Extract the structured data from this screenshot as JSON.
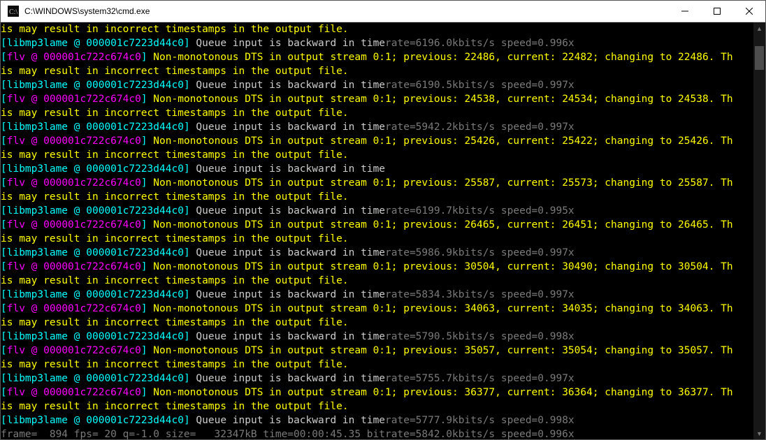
{
  "window": {
    "title": "C:\\WINDOWS\\system32\\cmd.exe"
  },
  "scrollbar": {
    "thumb_top_pct": 3,
    "thumb_height_pct": 6
  },
  "tags": {
    "mp3": {
      "name": "libmp3lame",
      "addr": "000001c7223d44c0"
    },
    "flv": {
      "name": "flv",
      "addr": "000001c722c674c0"
    }
  },
  "strings": {
    "queue_msg": "Queue input is backward in time",
    "wrap_msg": "is may result in incorrect timestamps in the output file."
  },
  "entries": [
    {
      "type": "wrap"
    },
    {
      "type": "mp3",
      "rate": "6196.0kbits/s",
      "speed": "0.996x"
    },
    {
      "type": "flv",
      "prev": "22486",
      "curr": "22482",
      "chg": "22486"
    },
    {
      "type": "wrap"
    },
    {
      "type": "mp3",
      "rate": "6190.5kbits/s",
      "speed": "0.997x"
    },
    {
      "type": "flv",
      "prev": "24538",
      "curr": "24534",
      "chg": "24538"
    },
    {
      "type": "wrap"
    },
    {
      "type": "mp3",
      "rate": "5942.2kbits/s",
      "speed": "0.997x"
    },
    {
      "type": "flv",
      "prev": "25426",
      "curr": "25422",
      "chg": "25426"
    },
    {
      "type": "wrap"
    },
    {
      "type": "mp3",
      "rate": null,
      "speed": null
    },
    {
      "type": "flv",
      "prev": "25587",
      "curr": "25573",
      "chg": "25587"
    },
    {
      "type": "wrap"
    },
    {
      "type": "mp3",
      "rate": "6199.7kbits/s",
      "speed": "0.995x"
    },
    {
      "type": "flv",
      "prev": "26465",
      "curr": "26451",
      "chg": "26465"
    },
    {
      "type": "wrap"
    },
    {
      "type": "mp3",
      "rate": "5986.9kbits/s",
      "speed": "0.997x"
    },
    {
      "type": "flv",
      "prev": "30504",
      "curr": "30490",
      "chg": "30504"
    },
    {
      "type": "wrap"
    },
    {
      "type": "mp3",
      "rate": "5834.3kbits/s",
      "speed": "0.997x"
    },
    {
      "type": "flv",
      "prev": "34063",
      "curr": "34035",
      "chg": "34063"
    },
    {
      "type": "wrap"
    },
    {
      "type": "mp3",
      "rate": "5790.5kbits/s",
      "speed": "0.998x"
    },
    {
      "type": "flv",
      "prev": "35057",
      "curr": "35054",
      "chg": "35057"
    },
    {
      "type": "wrap"
    },
    {
      "type": "mp3",
      "rate": "5755.7kbits/s",
      "speed": "0.997x"
    },
    {
      "type": "flv",
      "prev": "36377",
      "curr": "36364",
      "chg": "36377"
    },
    {
      "type": "wrap"
    },
    {
      "type": "mp3",
      "rate": "5777.9kbits/s",
      "speed": "0.998x"
    }
  ],
  "status_line": {
    "frame": "894",
    "fps": "20",
    "q": "-1.0",
    "size": "32347kB",
    "time": "00:00:45.35",
    "bitrate": "5842.0kbits/s",
    "speed": "0.996x"
  }
}
